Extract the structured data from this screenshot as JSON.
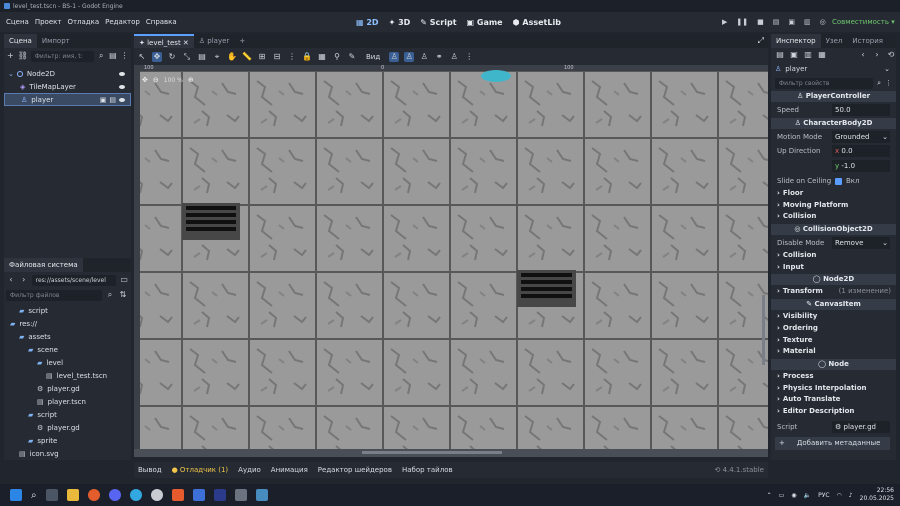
{
  "window": {
    "title": "level_test.tscn - BS-1 - Godot Engine"
  },
  "menu": [
    "Сцена",
    "Проект",
    "Отладка",
    "Редактор",
    "Справка"
  ],
  "workspaces": [
    {
      "label": "2D",
      "active": true
    },
    {
      "label": "3D"
    },
    {
      "label": "Script"
    },
    {
      "label": "Game"
    },
    {
      "label": "AssetLib"
    }
  ],
  "renderer": "Совместимость",
  "scene_dock": {
    "tabs": [
      "Сцена",
      "Импорт"
    ],
    "filter_placeholder": "Фильтр: имя, t:",
    "nodes": [
      {
        "label": "Node2D",
        "depth": 0
      },
      {
        "label": "TileMapLayer",
        "depth": 1
      },
      {
        "label": "player",
        "depth": 1,
        "selected": true
      }
    ]
  },
  "fs_dock": {
    "title": "Файловая система",
    "path": "res://assets/scene/level",
    "filter_placeholder": "Фильтр файлов",
    "items": [
      {
        "label": "script",
        "depth": 1
      },
      {
        "label": "res://",
        "depth": 0
      },
      {
        "label": "assets",
        "depth": 1
      },
      {
        "label": "scene",
        "depth": 2
      },
      {
        "label": "level",
        "depth": 3
      },
      {
        "label": "level_test.tscn",
        "depth": 4
      },
      {
        "label": "player.gd",
        "depth": 3
      },
      {
        "label": "player.tscn",
        "depth": 3
      },
      {
        "label": "script",
        "depth": 2
      },
      {
        "label": "player.gd",
        "depth": 3
      },
      {
        "label": "sprite",
        "depth": 2
      },
      {
        "label": "icon.svg",
        "depth": 1
      }
    ]
  },
  "editor_tabs": [
    {
      "label": "level_test",
      "active": true
    },
    {
      "label": "player"
    }
  ],
  "view_menu": "Вид",
  "zoom": "100 %",
  "ruler": {
    "a": "100",
    "b": "0",
    "c": "100"
  },
  "bottom_tabs": [
    "Вывод",
    "Отладчик (1)",
    "Аудио",
    "Анимация",
    "Редактор шейдеров",
    "Набор тайлов"
  ],
  "version": "4.4.1.stable",
  "inspector": {
    "tabs": [
      "Инспектор",
      "Узел",
      "История"
    ],
    "object": "player",
    "filter_placeholder": "Фильтр свойств",
    "player_controller": "PlayerController",
    "speed_label": "Speed",
    "speed_value": "50.0",
    "characterbody": "CharacterBody2D",
    "motion_mode_label": "Motion Mode",
    "motion_mode_value": "Grounded",
    "up_direction_label": "Up Direction",
    "up_x": "0.0",
    "up_y": "-1.0",
    "slide_label": "Slide on Ceiling",
    "slide_value": "Вкл",
    "groups_a": [
      "Floor",
      "Moving Platform",
      "Collision"
    ],
    "collisionobject": "CollisionObject2D",
    "disable_label": "Disable Mode",
    "disable_value": "Remove",
    "groups_b": [
      "Collision",
      "Input"
    ],
    "node2d": "Node2D",
    "transform_label": "Transform",
    "transform_note": "(1 изменение)",
    "canvasitem": "CanvasItem",
    "groups_c": [
      "Visibility",
      "Ordering",
      "Texture",
      "Material"
    ],
    "node": "Node",
    "groups_d": [
      "Process",
      "Physics Interpolation",
      "Auto Translate",
      "Editor Description"
    ],
    "script_label": "Script",
    "script_value": "player.gd",
    "add_meta": "Добавить метаданные"
  },
  "taskbar": {
    "lang": "РУС",
    "time": "22:56",
    "date": "20.05.2025"
  }
}
